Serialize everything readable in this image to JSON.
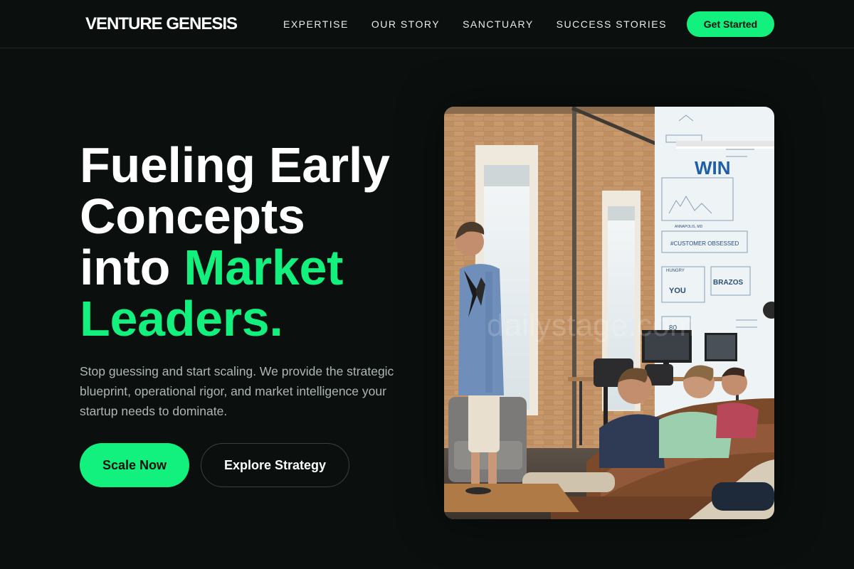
{
  "brand": {
    "name": "VENTURE GENESIS"
  },
  "nav": {
    "items": [
      {
        "label": "EXPERTISE"
      },
      {
        "label": "OUR STORY"
      },
      {
        "label": "SANCTUARY"
      },
      {
        "label": "SUCCESS STORIES"
      }
    ],
    "cta_label": "Get Started"
  },
  "hero": {
    "headline_line1": "Fueling Early",
    "headline_line2": "Concepts",
    "headline_line3_plain": "into ",
    "headline_line3_accent": "Market",
    "headline_line4_accent": "Leaders.",
    "subtext": "Stop guessing and start scaling. We provide the strategic blueprint, operational rigor, and market intelligence your startup needs to dominate.",
    "primary_button": "Scale Now",
    "secondary_button": "Explore Strategy",
    "image": {
      "wall_text_win": "WIN",
      "wall_text_customer": "#CUSTOMER OBSESSED",
      "wall_text_brazos": "BRAZOS",
      "wall_text_80": "80",
      "wall_text_hungry": "HUNGRY",
      "wall_text_you": "YOU",
      "wall_text_annapolis": "ANNAPOLIS, MD",
      "watermark": "dailystage.com"
    }
  },
  "colors": {
    "background": "#0b100e",
    "accent": "#12f07e",
    "text": "#ffffff",
    "muted_text": "#aeb6b2"
  }
}
